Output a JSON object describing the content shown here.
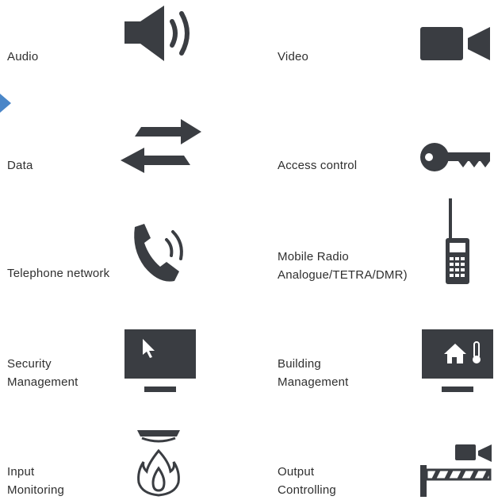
{
  "colors": {
    "icon": "#3a3d42",
    "accent": "#4a86c8",
    "fire": "#3a3d42"
  },
  "items": [
    {
      "label": "Audio",
      "icon": "speaker-icon"
    },
    {
      "label": "Video",
      "icon": "video-camera-icon"
    },
    {
      "label": "Data",
      "icon": "data-arrows-icon"
    },
    {
      "label": "Access control",
      "icon": "key-icon"
    },
    {
      "label": "Telephone network",
      "icon": "phone-icon"
    },
    {
      "label_line1": "Mobile Radio",
      "label_line2": "Analogue/TETRA/DMR)",
      "icon": "radio-icon"
    },
    {
      "label_line1": "Security",
      "label_line2": "Management",
      "icon": "monitor-cursor-icon"
    },
    {
      "label_line1": "Building",
      "label_line2": "Management",
      "icon": "monitor-house-icon"
    },
    {
      "label_line1": "Input",
      "label_line2": "Monitoring",
      "icon": "smoke-detector-fire-icon"
    },
    {
      "label_line1": "Output",
      "label_line2": "Controlling",
      "icon": "barrier-camera-icon"
    }
  ]
}
